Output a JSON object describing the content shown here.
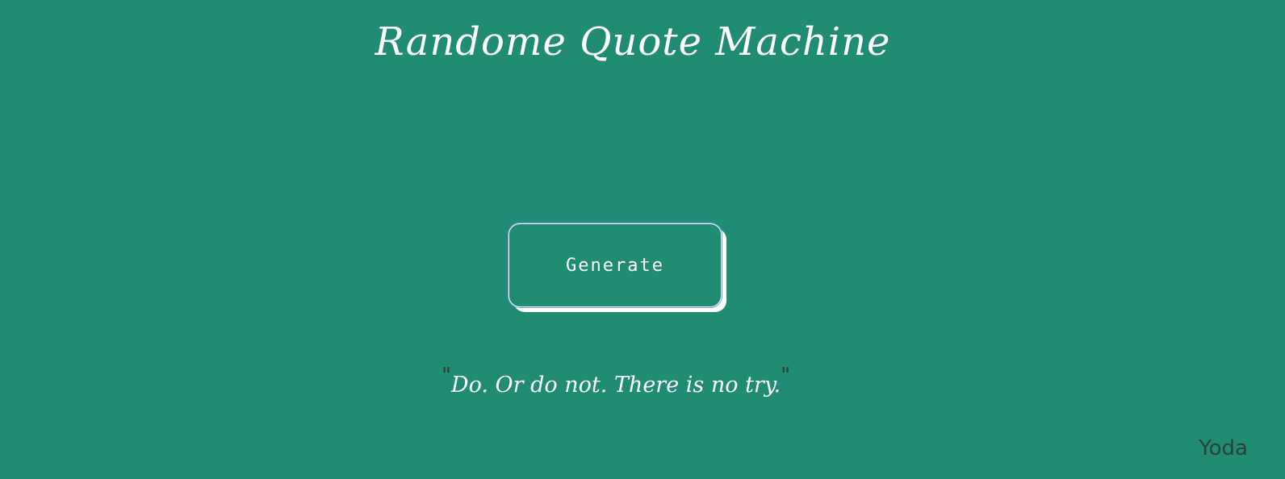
{
  "page": {
    "title": "Randome Quote Machine"
  },
  "controls": {
    "generate_label": "Generate"
  },
  "quote": {
    "open_mark": "\"",
    "text": "Do. Or do not. There is no try.",
    "close_mark": "\"",
    "author": "Yoda"
  },
  "colors": {
    "background": "#218c74",
    "text": "#ffffff",
    "author": "#2f3d3a"
  }
}
